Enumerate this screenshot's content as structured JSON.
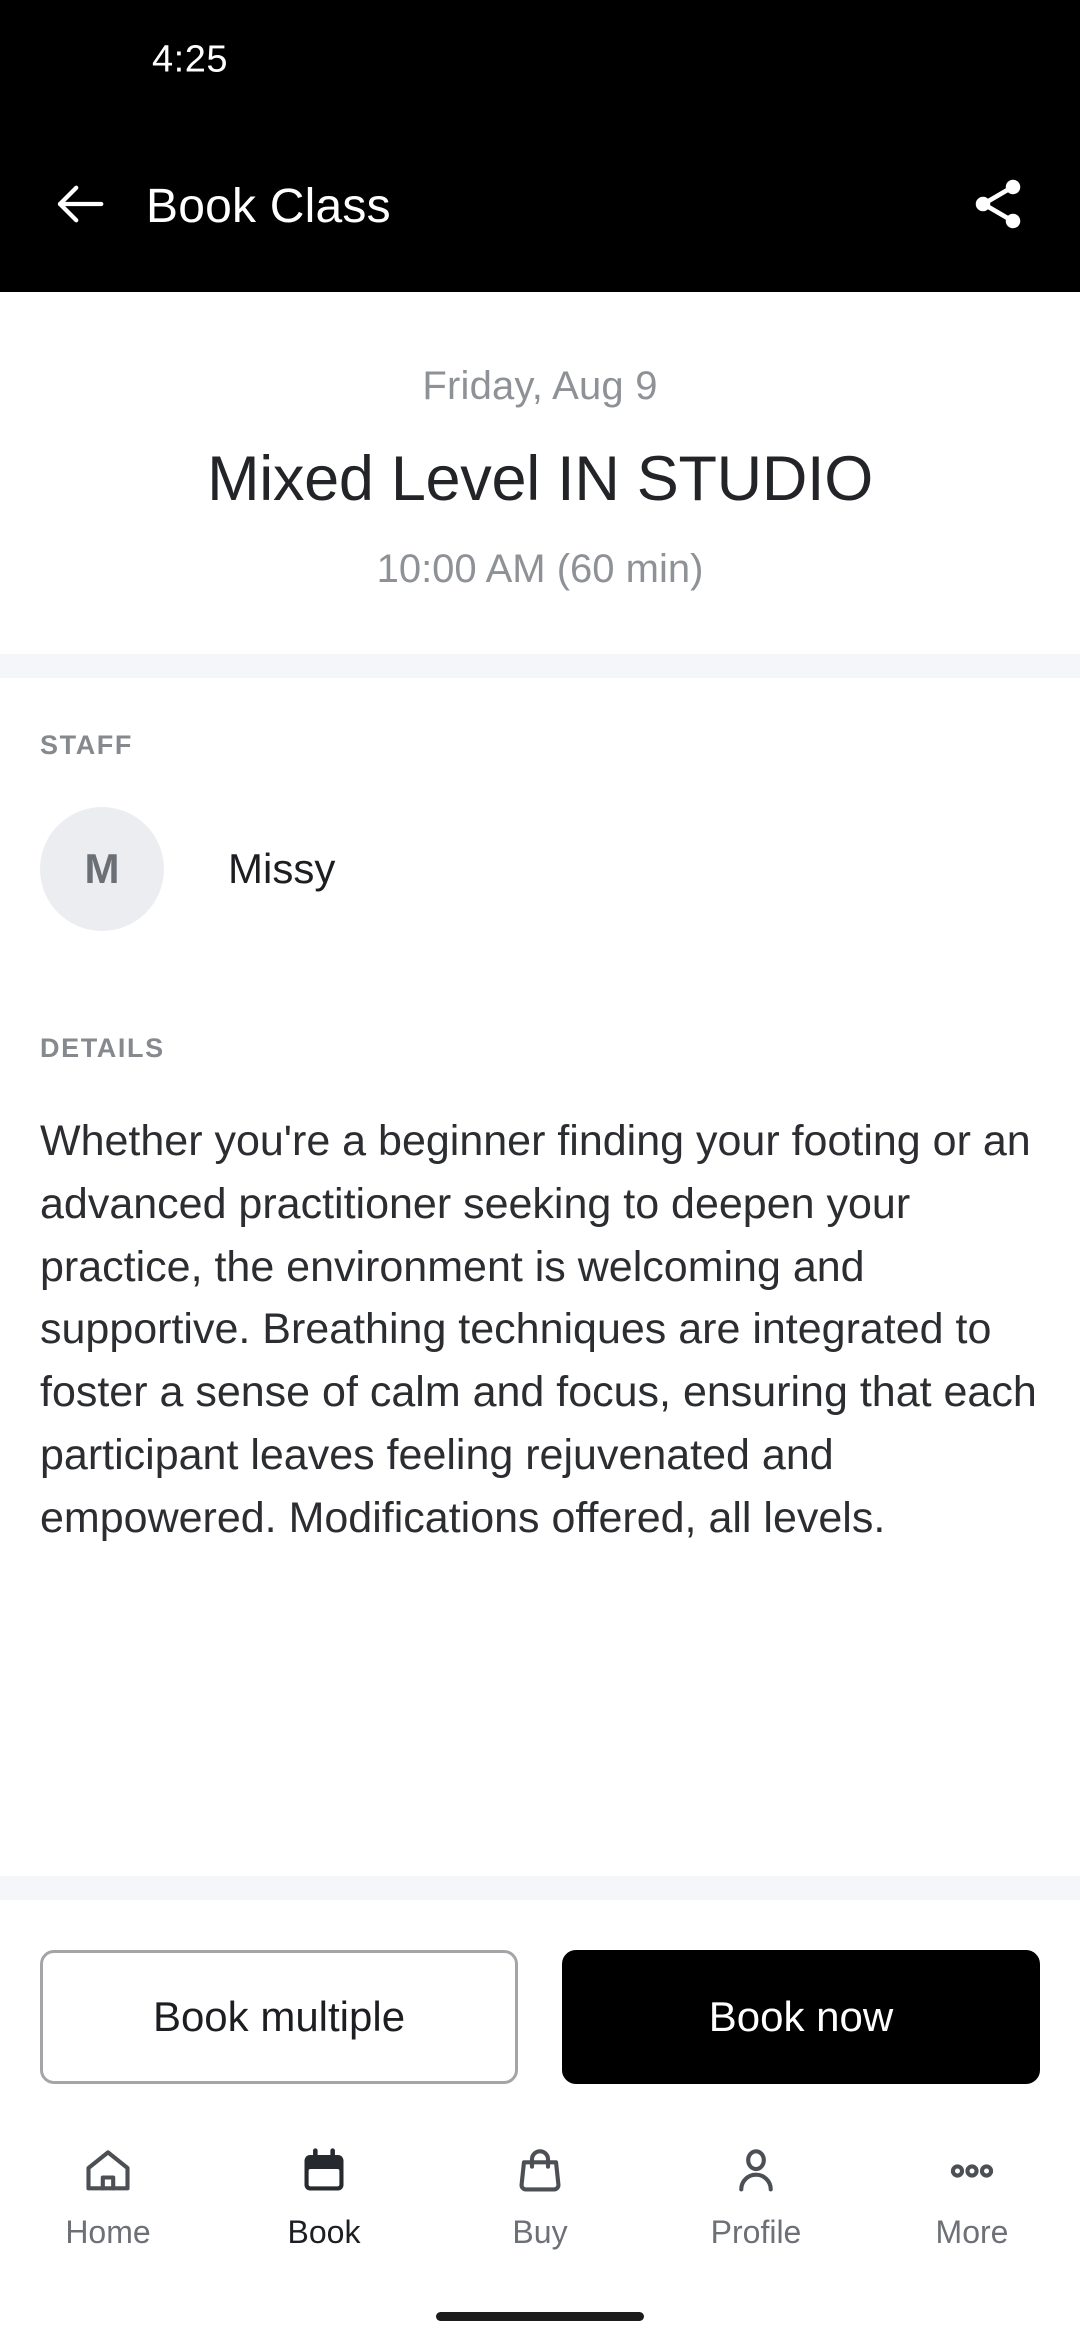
{
  "statusbar": {
    "clock": "4:25"
  },
  "appbar": {
    "title": "Book Class",
    "back_icon": "arrow-left-icon",
    "share_icon": "share-icon",
    "background": "#000000",
    "foreground": "#ffffff"
  },
  "class": {
    "date": "Friday, Aug 9",
    "name": "Mixed Level IN STUDIO",
    "time": "10:00 AM (60 min)"
  },
  "staff_section": {
    "label": "STAFF",
    "members": [
      {
        "initial": "M",
        "name": "Missy"
      }
    ]
  },
  "details_section": {
    "label": "DETAILS",
    "text": "Whether you're a beginner finding your footing or an advanced practitioner seeking to deepen your practice, the environment is welcoming and supportive. Breathing techniques are integrated to foster a sense of calm and focus, ensuring that each participant leaves feeling rejuvenated and empowered. Modifications offered, all levels."
  },
  "actions": {
    "secondary_label": "Book multiple",
    "primary_label": "Book now",
    "primary_bg": "#000000",
    "secondary_border": "#a3a5a8"
  },
  "bottom_nav": {
    "items": [
      {
        "label": "Home",
        "icon": "home-icon",
        "active": false
      },
      {
        "label": "Book",
        "icon": "calendar-icon",
        "active": true
      },
      {
        "label": "Buy",
        "icon": "shopping-bag-icon",
        "active": false
      },
      {
        "label": "Profile",
        "icon": "person-icon",
        "active": false
      },
      {
        "label": "More",
        "icon": "ellipsis-icon",
        "active": false
      }
    ]
  },
  "colors": {
    "muted_text": "#8e9196",
    "primary_text": "#222428",
    "divider": "#f4f6f9",
    "avatar_bg": "#ecedf0"
  }
}
